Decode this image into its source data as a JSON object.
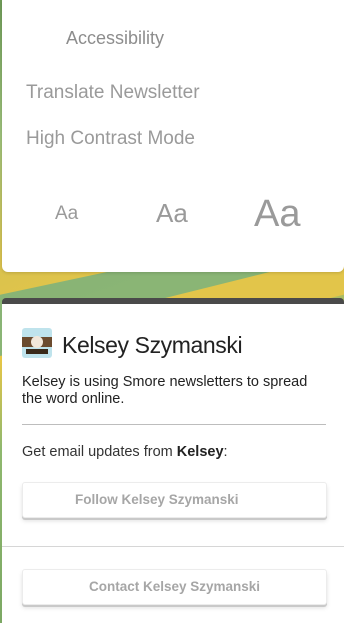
{
  "accessibility": {
    "title": "Accessibility",
    "translate_label": "Translate Newsletter",
    "contrast_label": "High Contrast Mode",
    "text_sizes": [
      "Aa",
      "Aa",
      "Aa"
    ]
  },
  "author": {
    "name": "Kelsey Szymanski",
    "description": "Kelsey is using Smore newsletters to spread the word online.",
    "updates_prefix": "Get email updates from ",
    "updates_name": "Kelsey",
    "updates_suffix": ":",
    "follow_label": "Follow Kelsey Szymanski",
    "contact_label": "Contact Kelsey Szymanski"
  },
  "colors": {
    "card_top_border": "#4a4a4a",
    "muted_text": "#9a9a9a",
    "button_text": "#a6a6a6"
  }
}
